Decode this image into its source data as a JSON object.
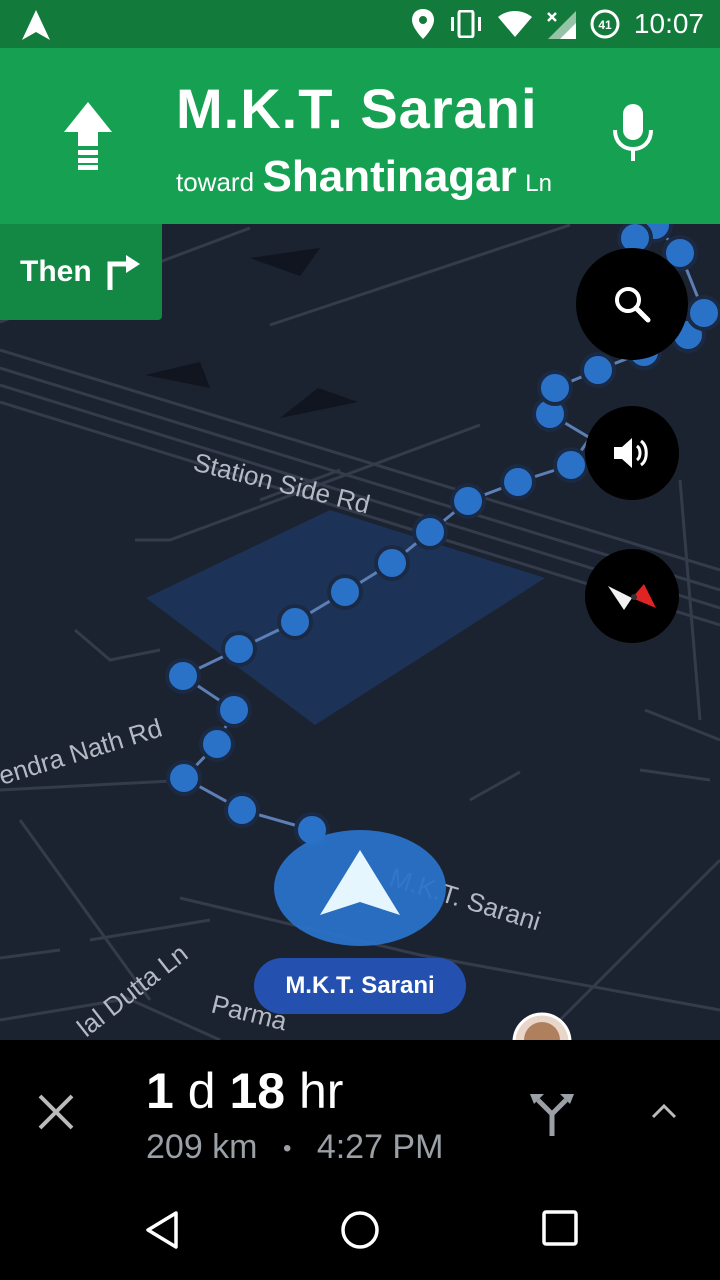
{
  "status_bar": {
    "time": "10:07",
    "battery": "41"
  },
  "header": {
    "street": "M.K.T. Sarani",
    "toward_prefix": "toward",
    "destination": "Shantinagar",
    "destination_suffix": "Ln"
  },
  "next_turn": {
    "label": "Then"
  },
  "map": {
    "road_labels": {
      "station_side": "Station Side Rd",
      "nath": "endra Nath Rd",
      "mkt": "M.K.T. Sarani",
      "dutta": "lal Dutta Ln",
      "parma": "Parma"
    },
    "current_road_chip": "M.K.T. Sarani"
  },
  "trip": {
    "days": "1",
    "days_unit": "d",
    "hours": "18",
    "hours_unit": "hr",
    "distance": "209 km",
    "separator": "•",
    "arrival": "4:27 PM"
  },
  "colors": {
    "header_green": "#16a152",
    "route_blue": "#2a72c8",
    "map_bg": "#1b2230"
  }
}
